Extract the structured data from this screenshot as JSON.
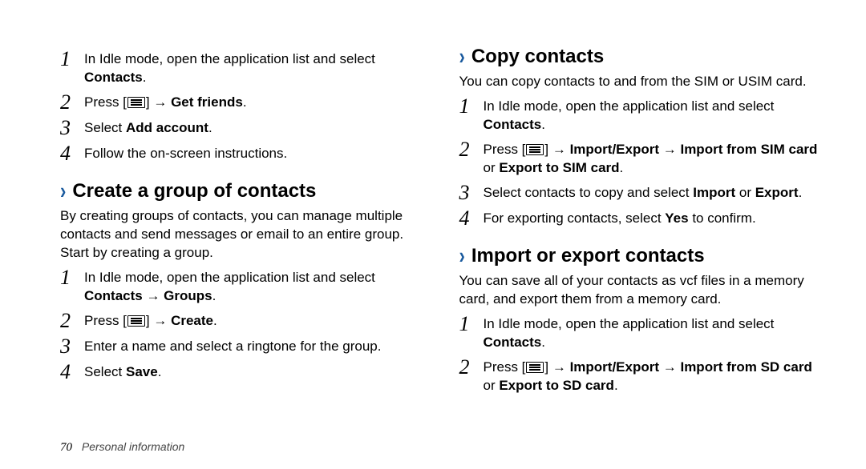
{
  "left": {
    "steps1": [
      {
        "n": "1",
        "pre": "In Idle mode, open the application list and select ",
        "bold": "Contacts",
        "post": "."
      },
      {
        "n": "2",
        "pre": "Press [",
        "icon": true,
        "mid": "] → ",
        "bold": "Get friends",
        "post": "."
      },
      {
        "n": "3",
        "pre": "Select ",
        "bold": "Add account",
        "post": "."
      },
      {
        "n": "4",
        "pre": "Follow the on-screen instructions.",
        "bold": "",
        "post": ""
      }
    ],
    "heading2": "Create a group of contacts",
    "intro2": "By creating groups of contacts, you can manage multiple contacts and send messages or email to an entire group. Start by creating a group.",
    "steps2": [
      {
        "n": "1",
        "pre": "In Idle mode, open the application list and select ",
        "bold": "Contacts → Groups",
        "post": "."
      },
      {
        "n": "2",
        "pre": "Press [",
        "icon": true,
        "mid": "] → ",
        "bold": "Create",
        "post": "."
      },
      {
        "n": "3",
        "pre": "Enter a name and select a ringtone for the group.",
        "bold": "",
        "post": ""
      },
      {
        "n": "4",
        "pre": "Select ",
        "bold": "Save",
        "post": "."
      }
    ]
  },
  "right": {
    "heading1": "Copy contacts",
    "intro1": "You can copy contacts to and from the SIM or USIM card.",
    "steps1": [
      {
        "n": "1",
        "pre": "In Idle mode, open the application list and select ",
        "bold": "Contacts",
        "post": "."
      },
      {
        "n": "2",
        "pre": "Press [",
        "icon": true,
        "mid": "] → ",
        "bold": "Import/Export → Import from SIM card",
        "mid2": " or ",
        "bold2": "Export to SIM card",
        "post": "."
      },
      {
        "n": "3",
        "pre": "Select contacts to copy and select ",
        "bold": "Import",
        "mid2": " or ",
        "bold2": "Export",
        "post": "."
      },
      {
        "n": "4",
        "pre": "For exporting contacts, select ",
        "bold": "Yes",
        "post": " to confirm."
      }
    ],
    "heading2": "Import or export contacts",
    "intro2": "You can save all of your contacts as vcf files in a memory card, and export them from a memory card.",
    "steps2": [
      {
        "n": "1",
        "pre": "In Idle mode, open the application list and select ",
        "bold": "Contacts",
        "post": "."
      },
      {
        "n": "2",
        "pre": "Press [",
        "icon": true,
        "mid": "] → ",
        "bold": "Import/Export → Import from SD card",
        "mid2": " or ",
        "bold2": "Export to SD card",
        "post": "."
      }
    ]
  },
  "footer": {
    "page": "70",
    "section": "Personal information"
  }
}
